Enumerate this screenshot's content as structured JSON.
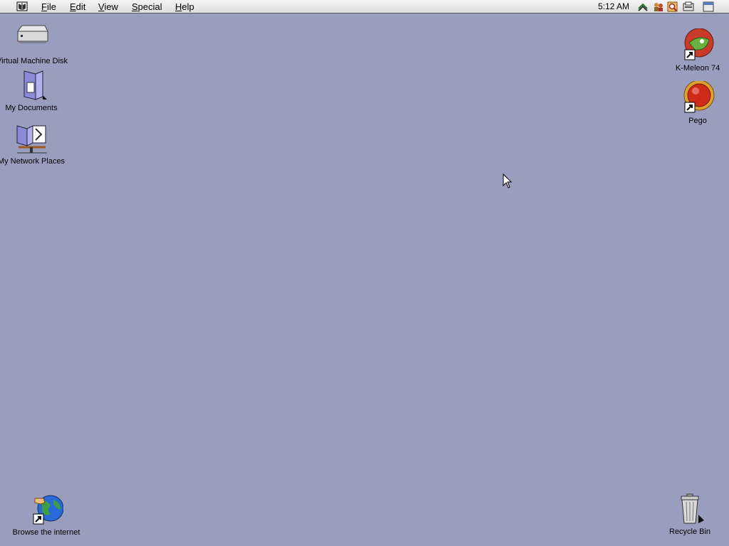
{
  "menubar": {
    "menus": [
      {
        "pre": "",
        "u": "F",
        "post": "ile"
      },
      {
        "pre": "",
        "u": "E",
        "post": "dit"
      },
      {
        "pre": "",
        "u": "V",
        "post": "iew"
      },
      {
        "pre": "",
        "u": "S",
        "post": "pecial"
      },
      {
        "pre": "",
        "u": "H",
        "post": "elp"
      }
    ],
    "clock": "5:12 AM",
    "tray_icons": [
      "network-icon",
      "people-icon",
      "search-icon",
      "hardware-icon",
      "window-icon"
    ]
  },
  "desktop": {
    "background_color": "#9a9ebe",
    "icons": {
      "vm_disk": "Virtual Machine Disk",
      "my_documents": "My Documents",
      "network_places": "My Network Places",
      "kmeleon": "K-Meleon 74",
      "pego": "Pego",
      "browse": "Browse the internet",
      "recycle": "Recycle Bin"
    }
  }
}
